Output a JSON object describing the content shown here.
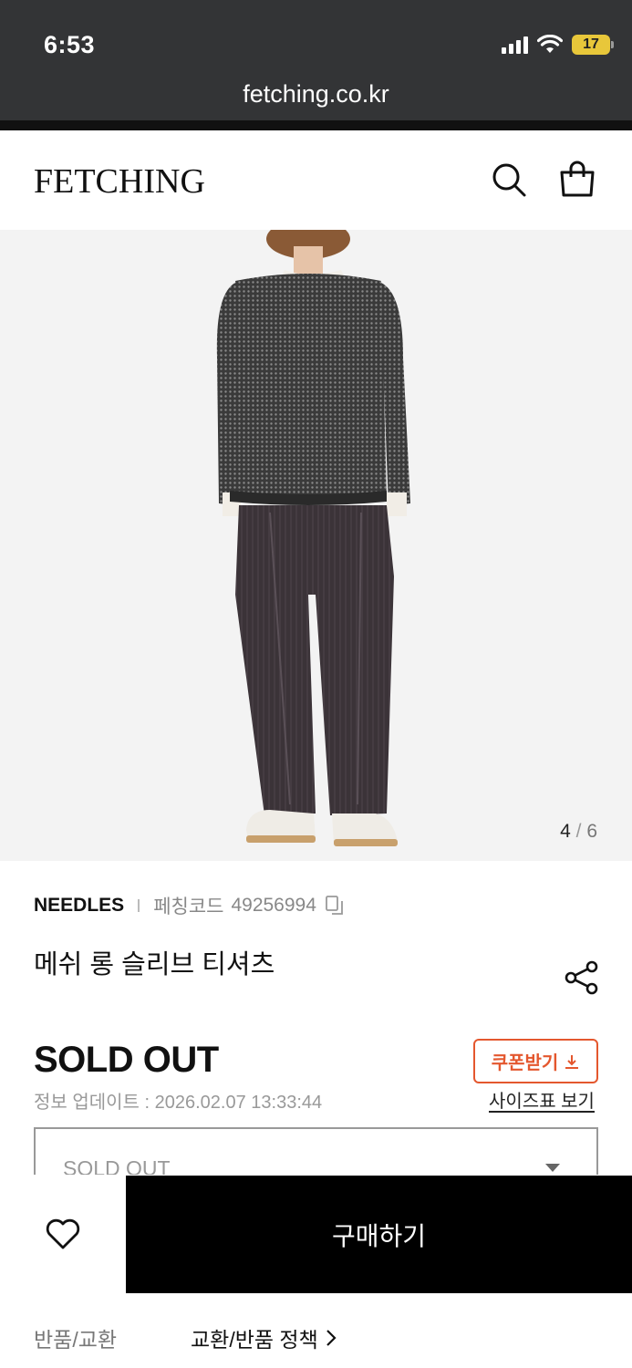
{
  "status_bar": {
    "time": "6:53",
    "battery": "17"
  },
  "browser": {
    "url": "fetching.co.kr"
  },
  "header": {
    "logo": "FETCHING"
  },
  "gallery": {
    "current": "4",
    "separator": "/",
    "total": "6"
  },
  "product": {
    "brand": "NEEDLES",
    "code_label": "페칭코드",
    "code_value": "49256994",
    "title": "메쉬 롱 슬리브 티셔츠",
    "price_status": "SOLD OUT",
    "updated": "정보 업데이트 : 2026.02.07 13:33:44",
    "coupon_label": "쿠폰받기",
    "size_chart_label": "사이즈표 보기"
  },
  "option_select": {
    "value": "SOLD OUT"
  },
  "buy_bar": {
    "buy_label": "구매하기"
  },
  "policy": {
    "label": "반품/교환",
    "link": "교환/반품 정책"
  },
  "colors": {
    "coupon": "#e4572e",
    "buy_button": "#000000",
    "browser_chrome": "#333436"
  }
}
